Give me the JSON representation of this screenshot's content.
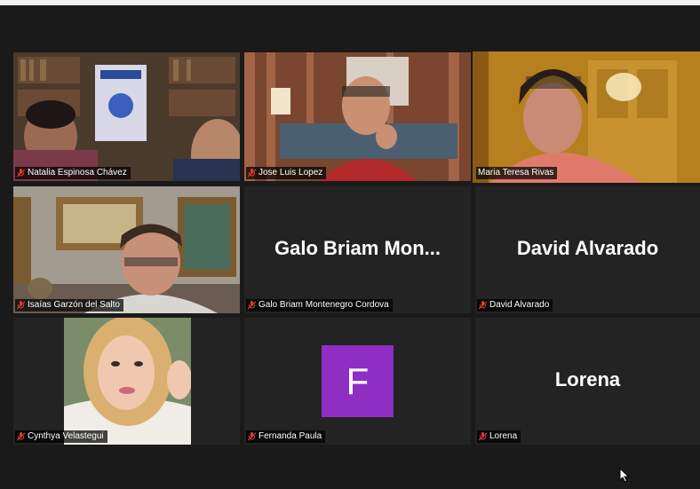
{
  "colors": {
    "active_speaker_border": "#e3e046",
    "avatar_bg": "#8e2ec2",
    "background": "#1a1a1a",
    "tile_bg": "#232323",
    "mic_muted": "#e03a2f"
  },
  "participants": [
    {
      "name": "Natalia Espinosa Chávez",
      "video": true,
      "muted": true
    },
    {
      "name": "Jose Luis Lopez",
      "video": true,
      "muted": true
    },
    {
      "name": "Maria Teresa Rivas",
      "video": true,
      "muted": false,
      "active": true
    },
    {
      "name": "Isaías Garzón del Salto",
      "video": true,
      "muted": true
    },
    {
      "name": "Galo Briam Montenegro Cordova",
      "display": "Galo  Briam  Mon...",
      "video": false,
      "muted": true
    },
    {
      "name": "David Alvarado",
      "display": "David Alvarado",
      "video": false,
      "muted": true
    },
    {
      "name": "Cynthya Velastegui",
      "video": true,
      "muted": true
    },
    {
      "name": "Fernanda Paula",
      "avatar_letter": "F",
      "video": false,
      "muted": true
    },
    {
      "name": "Lorena",
      "display": "Lorena",
      "video": false,
      "muted": true
    }
  ],
  "icons": {
    "mic_muted": "mic-muted-icon",
    "cursor": "mouse-cursor-icon"
  }
}
